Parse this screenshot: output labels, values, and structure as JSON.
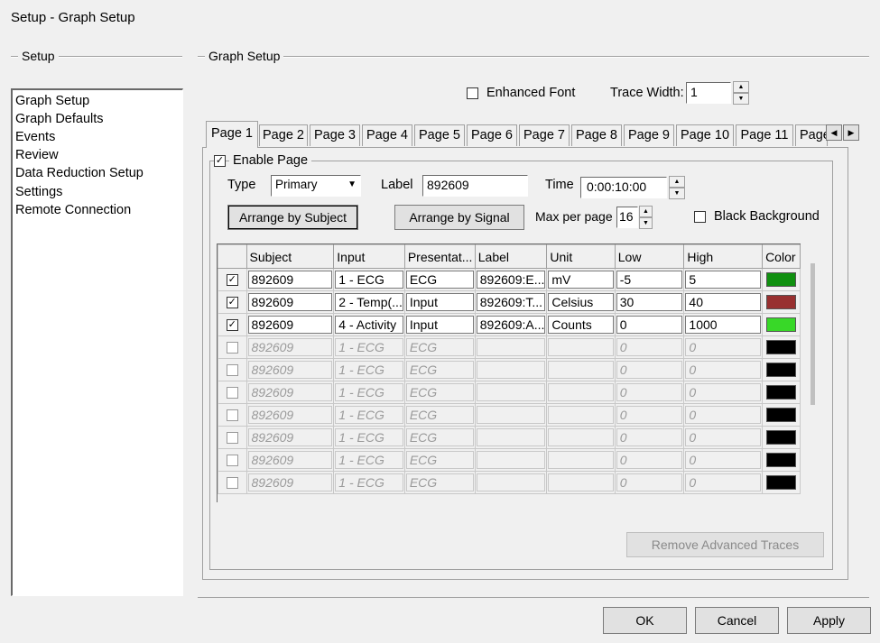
{
  "window": {
    "title": "Setup - Graph Setup"
  },
  "left_group": {
    "title": "Setup",
    "items": [
      "Graph Setup",
      "Graph Defaults",
      "Events",
      "Review",
      "Data Reduction Setup",
      "Settings",
      "Remote Connection"
    ],
    "selected": "Graph Setup"
  },
  "right_group": {
    "title": "Graph Setup"
  },
  "options": {
    "enhanced_font_label": "Enhanced Font",
    "enhanced_font_checked": false,
    "trace_width_label": "Trace Width:",
    "trace_width_value": "1"
  },
  "tabs": [
    "Page 1",
    "Page 2",
    "Page 3",
    "Page 4",
    "Page 5",
    "Page 6",
    "Page 7",
    "Page 8",
    "Page 9",
    "Page 10",
    "Page 11",
    "Page"
  ],
  "active_tab": "Page 1",
  "page": {
    "enable_label": "Enable Page",
    "enable_mark": "✓",
    "type_label": "Type",
    "type_value": "Primary",
    "label_label": "Label",
    "label_value": "892609",
    "time_label": "Time",
    "time_value": "0:00:10:00",
    "arrange_subject": "Arrange by Subject",
    "arrange_signal": "Arrange by Signal",
    "max_per_page_label": "Max per page",
    "max_per_page_value": "16",
    "black_bg_label": "Black Background"
  },
  "table": {
    "headers": [
      "",
      "Subject",
      "Input",
      "Presentat...",
      "Label",
      "Unit",
      "Low",
      "High",
      "Color"
    ],
    "rows": [
      {
        "checked": true,
        "subject": "892609",
        "input": "1 - ECG",
        "presentation": "ECG",
        "label": "892609:E...",
        "unit": "mV",
        "low": "-5",
        "high": "5",
        "color": "#109010"
      },
      {
        "checked": true,
        "subject": "892609",
        "input": "2 - Temp(...",
        "presentation": "Input",
        "label": "892609:T...",
        "unit": "Celsius",
        "low": "30",
        "high": "40",
        "color": "#983030"
      },
      {
        "checked": true,
        "subject": "892609",
        "input": "4 - Activity",
        "presentation": "Input",
        "label": "892609:A...",
        "unit": "Counts",
        "low": "0",
        "high": "1000",
        "color": "#38d828"
      },
      {
        "checked": false,
        "subject": "892609",
        "input": "1 - ECG",
        "presentation": "ECG",
        "label": "",
        "unit": "",
        "low": "0",
        "high": "0",
        "color": "#000000"
      },
      {
        "checked": false,
        "subject": "892609",
        "input": "1 - ECG",
        "presentation": "ECG",
        "label": "",
        "unit": "",
        "low": "0",
        "high": "0",
        "color": "#000000"
      },
      {
        "checked": false,
        "subject": "892609",
        "input": "1 - ECG",
        "presentation": "ECG",
        "label": "",
        "unit": "",
        "low": "0",
        "high": "0",
        "color": "#000000"
      },
      {
        "checked": false,
        "subject": "892609",
        "input": "1 - ECG",
        "presentation": "ECG",
        "label": "",
        "unit": "",
        "low": "0",
        "high": "0",
        "color": "#000000"
      },
      {
        "checked": false,
        "subject": "892609",
        "input": "1 - ECG",
        "presentation": "ECG",
        "label": "",
        "unit": "",
        "low": "0",
        "high": "0",
        "color": "#000000"
      },
      {
        "checked": false,
        "subject": "892609",
        "input": "1 - ECG",
        "presentation": "ECG",
        "label": "",
        "unit": "",
        "low": "0",
        "high": "0",
        "color": "#000000"
      },
      {
        "checked": false,
        "subject": "892609",
        "input": "1 - ECG",
        "presentation": "ECG",
        "label": "",
        "unit": "",
        "low": "0",
        "high": "0",
        "color": "#000000"
      }
    ]
  },
  "remove_advanced_traces": "Remove Advanced Traces",
  "footer": {
    "ok": "OK",
    "cancel": "Cancel",
    "apply": "Apply"
  },
  "icons": {
    "check_mark": "✓",
    "dropdown": "▼",
    "spin_up": "▲",
    "spin_down": "▼",
    "tab_left": "◀",
    "tab_right": "▶"
  }
}
